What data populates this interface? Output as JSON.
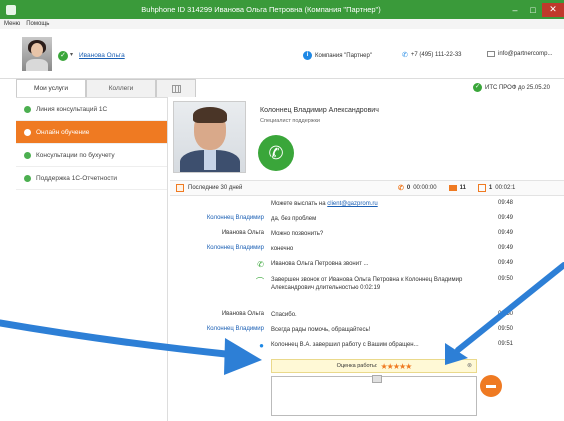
{
  "window": {
    "title": "Buhphone ID 314299 Иванова Ольга Петровна (Компания \"Партнер\")",
    "minimize": "–",
    "maximize": "□",
    "close": "✕"
  },
  "menu": {
    "items": [
      "Меню",
      "Помощь"
    ]
  },
  "user": {
    "name": "Иванова Ольга",
    "status_mark": "✓",
    "caret": "▾"
  },
  "header": {
    "company": "Компания \"Партнер\"",
    "phone": "+7 (495) 111-22-33",
    "email": "info@partnercomp..."
  },
  "tabs": [
    {
      "label": "Мои услуги"
    },
    {
      "label": "Коллеги"
    }
  ],
  "license": {
    "text": "ИТС ПРОФ до 25.05.20"
  },
  "sidebar": {
    "items": [
      {
        "label": "Линия консультаций 1С"
      },
      {
        "label": "Онлайн обучение"
      },
      {
        "label": "Консультации по бухучету"
      },
      {
        "label": "Поддержка 1С-Отчетности"
      }
    ]
  },
  "operator": {
    "name": "Колоннец Владимир Александрович",
    "role": "Специалист поддержки",
    "call_icon": "✆"
  },
  "stats": {
    "period": "Последние 30 дней",
    "calls": "0",
    "call_duration": "00:00:00",
    "chats": "11",
    "tasks": "1",
    "task_time": "00:02:1"
  },
  "messages": [
    {
      "author": "",
      "text_prefix": "Можете выслать на ",
      "link": "client@gazprom.ru",
      "time": "09:48"
    },
    {
      "author": "Колоннец Владимир",
      "text": "да, без проблем",
      "time": "09:49"
    },
    {
      "author": "Иванова Ольга",
      "text": "Можно позвонить?",
      "time": "09:49"
    },
    {
      "author": "Колоннец Владимир",
      "text": "конечно",
      "time": "09:49"
    },
    {
      "author": "",
      "text": "Иванова Ольга Петровна звонит ...",
      "time": "09:49"
    },
    {
      "author": "",
      "text": "Завершен звонок от Иванова Ольга Петровна к Колоннец Владимир Александрович длительностью 0:02:19",
      "time": "09:50"
    },
    {
      "author": "Иванова Ольга",
      "text": "Спасибо.",
      "time": "09:50"
    },
    {
      "author": "Колоннец Владимир",
      "text": "Всегда рады помочь, обращайтесь!",
      "time": "09:50"
    },
    {
      "author": "",
      "text": "Колоннец В.А. завершил работу с Вашим обращен...",
      "time": "09:51"
    }
  ],
  "rating": {
    "label": "Оценка работы:",
    "stars": "★★★★★",
    "value": 5,
    "close": "⊗"
  },
  "composer": {
    "placeholder": ""
  },
  "colors": {
    "accent": "#ef7a22",
    "brand_green": "#3aa63a",
    "link_blue": "#1a5fb4",
    "arrow_blue": "#2d7fd6"
  },
  "icons": [
    "info-icon",
    "phone-icon",
    "mail-icon",
    "grid-icon",
    "check-icon",
    "calendar-icon",
    "chat-icon",
    "task-icon",
    "call-icon",
    "person-icon",
    "send-icon",
    "attach-icon"
  ]
}
